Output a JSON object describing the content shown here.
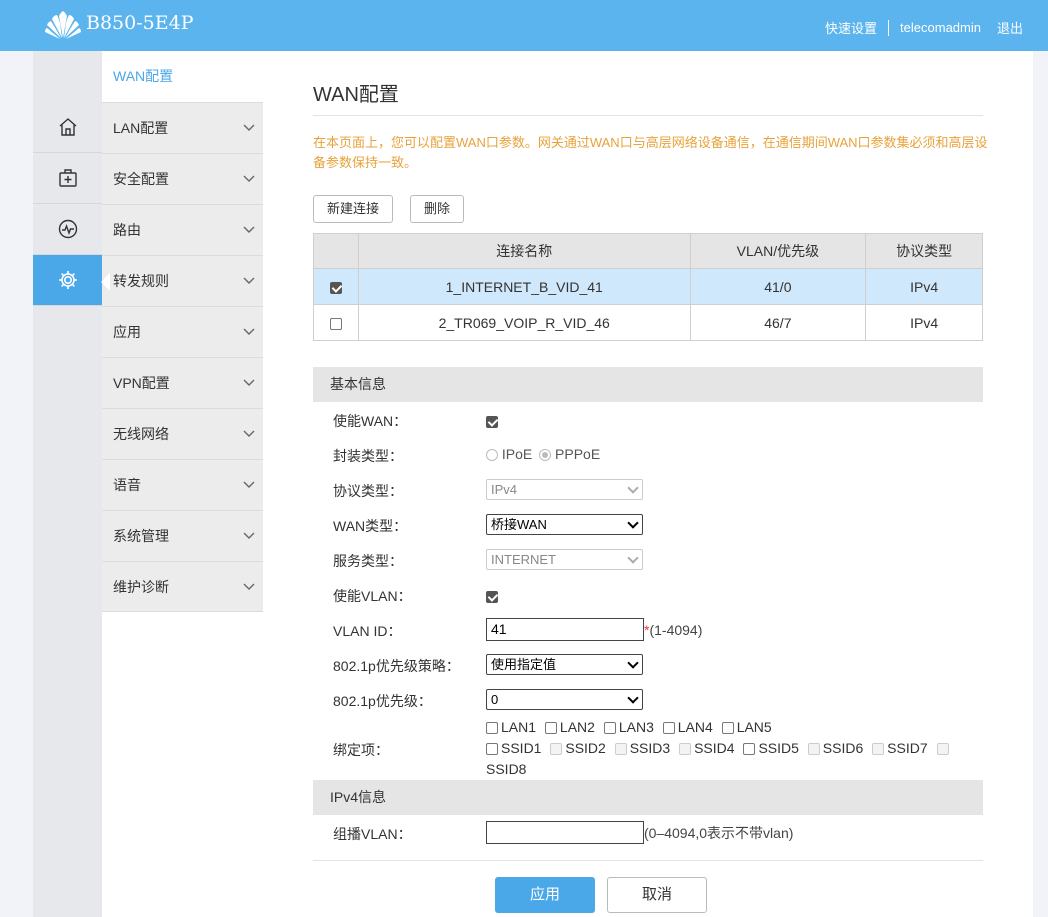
{
  "header": {
    "model": "B850-5E4P",
    "quick_setup": "快速设置",
    "user": "telecomadmin",
    "logout": "退出"
  },
  "rail": {
    "icons": [
      "home-icon",
      "firstaid-icon",
      "monitor-icon",
      "gear-icon"
    ],
    "active_index": 3
  },
  "menu": {
    "current": "WAN配置",
    "items": [
      {
        "label": "LAN配置"
      },
      {
        "label": "安全配置"
      },
      {
        "label": "路由"
      },
      {
        "label": "转发规则"
      },
      {
        "label": "应用"
      },
      {
        "label": "VPN配置"
      },
      {
        "label": "无线网络"
      },
      {
        "label": "语音"
      },
      {
        "label": "系统管理"
      },
      {
        "label": "维护诊断"
      }
    ]
  },
  "page": {
    "title": "WAN配置",
    "notice": "在本页面上，您可以配置WAN口参数。网关通过WAN口与高层网络设备通信，在通信期间WAN口参数集必须和高层设备参数保持一致。",
    "new_button": "新建连接",
    "delete_button": "删除"
  },
  "table": {
    "headers": [
      "连接名称",
      "VLAN/优先级",
      "协议类型"
    ],
    "rows": [
      {
        "checked": true,
        "name": "1_INTERNET_B_VID_41",
        "vlan": "41/0",
        "proto": "IPv4"
      },
      {
        "checked": false,
        "name": "2_TR069_VOIP_R_VID_46",
        "vlan": "46/7",
        "proto": "IPv4"
      }
    ]
  },
  "basic": {
    "section": "基本信息",
    "enable_wan_label": "使能WAN：",
    "encap_label": "封装类型：",
    "encap_ipoe": "IPoE",
    "encap_pppoe": "PPPoE",
    "proto_label": "协议类型：",
    "proto_value": "IPv4",
    "wan_type_label": "WAN类型：",
    "wan_type_value": "桥接WAN",
    "service_label": "服务类型：",
    "service_value": "INTERNET",
    "enable_vlan_label": "使能VLAN：",
    "vlan_id_label": "VLAN ID：",
    "vlan_id_value": "41",
    "vlan_req": "*",
    "vlan_range": "(1-4094)",
    "prio_policy_label": "802.1p优先级策略：",
    "prio_policy_value": "使用指定值",
    "prio_label": "802.1p优先级：",
    "prio_value": "0",
    "bind_label": "绑定项：",
    "bind_row1": [
      "LAN1",
      "LAN2",
      "LAN3",
      "LAN4",
      "LAN5"
    ],
    "bind_row2": [
      "SSID1",
      "SSID2",
      "SSID3",
      "SSID4",
      "SSID5",
      "SSID6",
      "SSID7"
    ],
    "bind_row3": "SSID8"
  },
  "ipv4": {
    "section": "IPv4信息",
    "multicast_label": "组播VLAN：",
    "multicast_value": "",
    "multicast_hint": "(0–4094,0表示不带vlan)"
  },
  "actions": {
    "apply": "应用",
    "cancel": "取消"
  },
  "colors": {
    "header": "#5bb4ee",
    "accent": "#4aa7e8",
    "notice": "#e8a23a",
    "selected_row": "#cfe8fb"
  }
}
